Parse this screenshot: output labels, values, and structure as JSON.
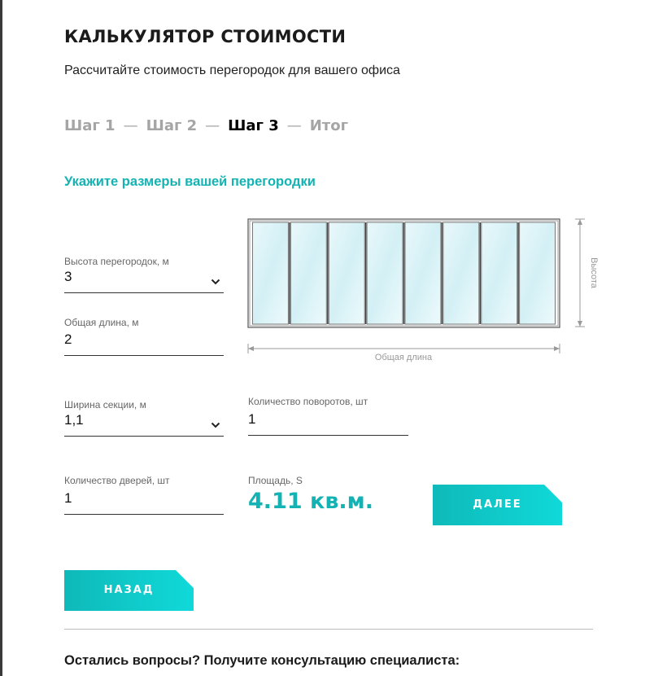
{
  "header": {
    "title": "КАЛЬКУЛЯТОР СТОИМОСТИ",
    "subtitle": "Рассчитайте стоимость перегородок для вашего офиса"
  },
  "steps": {
    "items": [
      "Шаг 1",
      "Шаг 2",
      "Шаг 3",
      "Итог"
    ],
    "separator": "—",
    "active": "Шаг 3"
  },
  "section": {
    "title": "Укажите размеры вашей перегородки"
  },
  "diagram": {
    "height_label": "Высота",
    "length_label": "Общая длина",
    "panels": 8
  },
  "form": {
    "height": {
      "label": "Высота перегородок, м",
      "value": "3"
    },
    "length": {
      "label": "Общая длина, м",
      "value": "2"
    },
    "section_width": {
      "label": "Ширина секции, м",
      "value": "1,1"
    },
    "turns": {
      "label": "Количество поворотов, шт",
      "value": "1"
    },
    "doors": {
      "label": "Количество дверей, шт",
      "value": "1"
    },
    "area": {
      "label": "Площадь, S",
      "value": "4.11 кв.м."
    }
  },
  "buttons": {
    "next": "ДАЛЕЕ",
    "back": "НАЗАД"
  },
  "footer": {
    "question": "Остались вопросы? Получите консультацию специалиста:"
  },
  "colors": {
    "accent": "#14b3b3",
    "button_from": "#0fb9b9",
    "button_to": "#10d9d9"
  }
}
